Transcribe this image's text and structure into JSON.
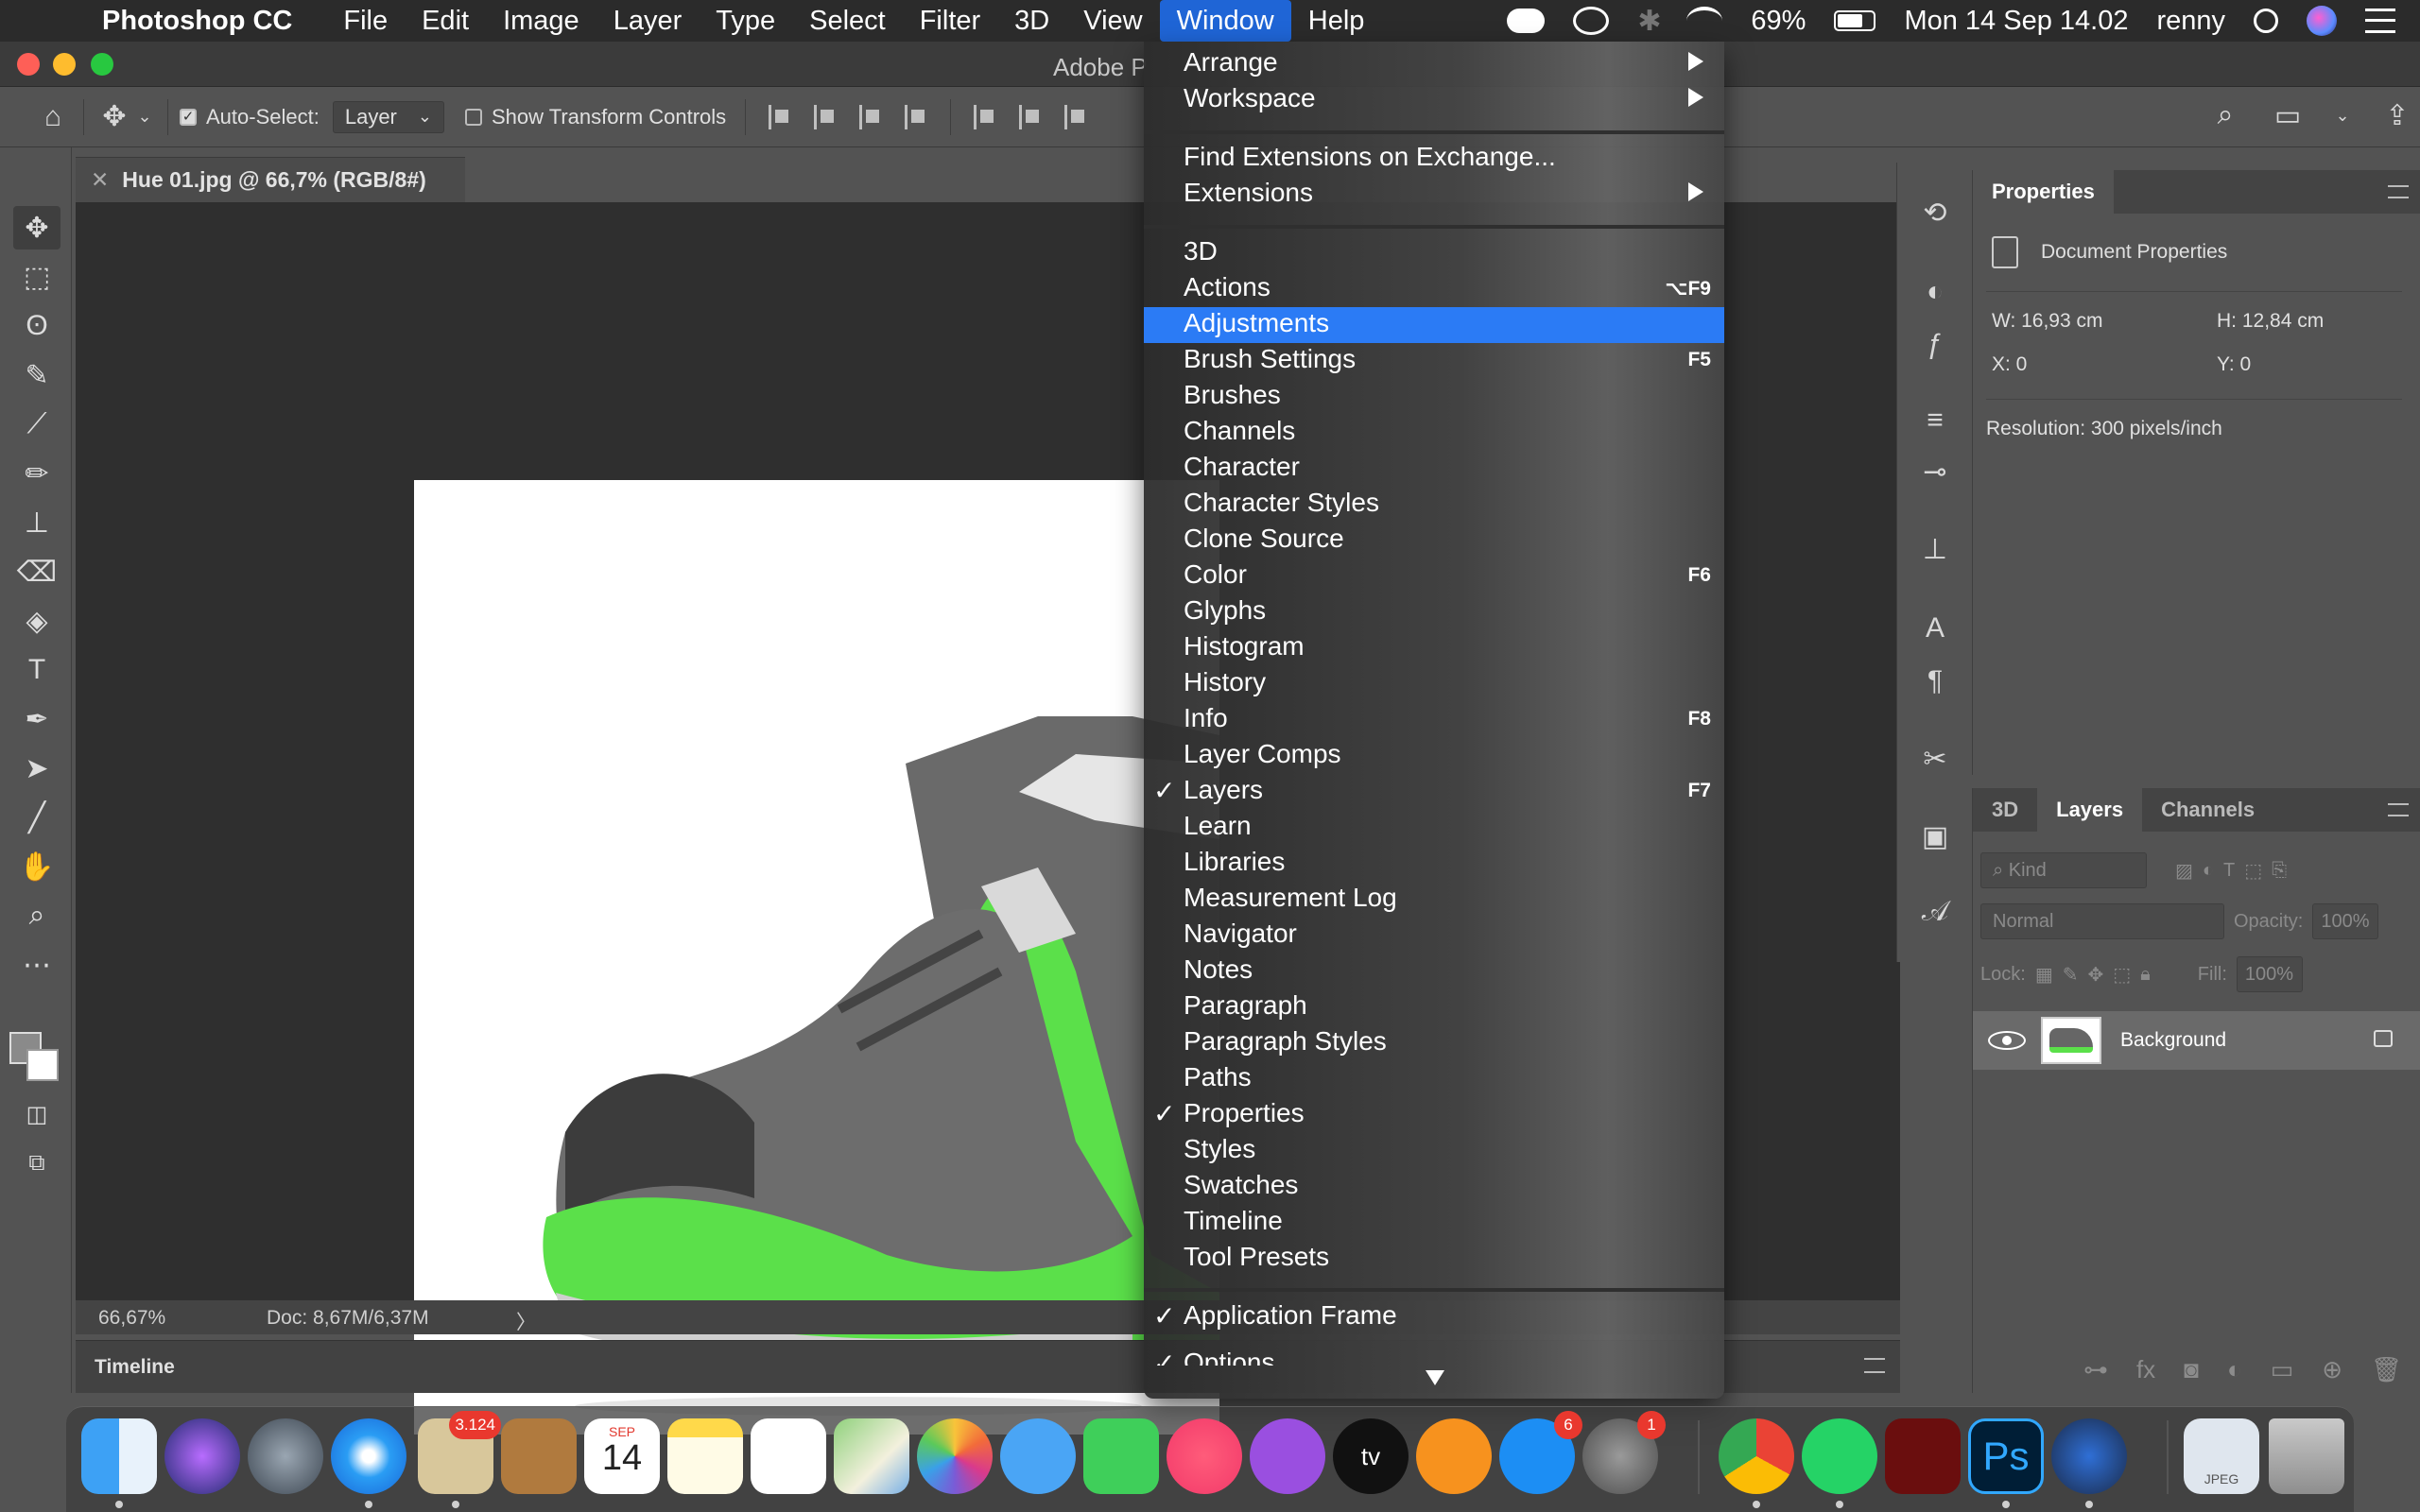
{
  "menubar": {
    "app_name": "Photoshop CC",
    "items": [
      "File",
      "Edit",
      "Image",
      "Layer",
      "Type",
      "Select",
      "Filter",
      "3D",
      "View",
      "Window",
      "Help"
    ],
    "active_item": "Window",
    "battery": "69%",
    "datetime": "Mon 14 Sep  14.02",
    "user": "renny"
  },
  "window": {
    "title": "Adobe P"
  },
  "options_bar": {
    "auto_select_label": "Auto-Select:",
    "auto_select_checked": true,
    "auto_select_value": "Layer",
    "transform_controls_label": "Show Transform Controls"
  },
  "document": {
    "tab_title": "Hue 01.jpg @ 66,7% (RGB/8#)",
    "zoom": "66,67%",
    "doc_info": "Doc: 8,67M/6,37M"
  },
  "timeline": {
    "label": "Timeline"
  },
  "properties_panel": {
    "tab": "Properties",
    "section": "Document Properties",
    "width": "W:  16,93 cm",
    "height": "H:  12,84 cm",
    "x": "X:  0",
    "y": "Y:  0",
    "resolution": "Resolution: 300 pixels/inch"
  },
  "layers_panel": {
    "tabs": [
      "3D",
      "Layers",
      "Channels"
    ],
    "active_tab": "Layers",
    "kind_placeholder": "Kind",
    "blend_mode": "Normal",
    "opacity_label": "Opacity:",
    "opacity_value": "100%",
    "lock_label": "Lock:",
    "fill_label": "Fill:",
    "fill_value": "100%",
    "layer_name": "Background"
  },
  "window_menu": {
    "items": [
      {
        "label": "Arrange",
        "submenu": true
      },
      {
        "label": "Workspace",
        "submenu": true
      },
      {
        "label": "Find Extensions on Exchange..."
      },
      {
        "label": "Extensions",
        "submenu": true
      },
      {
        "label": "3D"
      },
      {
        "label": "Actions",
        "shortcut": "⌥F9"
      },
      {
        "label": "Adjustments",
        "highlighted": true
      },
      {
        "label": "Brush Settings",
        "shortcut": "F5"
      },
      {
        "label": "Brushes"
      },
      {
        "label": "Channels"
      },
      {
        "label": "Character"
      },
      {
        "label": "Character Styles"
      },
      {
        "label": "Clone Source"
      },
      {
        "label": "Color",
        "shortcut": "F6"
      },
      {
        "label": "Glyphs"
      },
      {
        "label": "Histogram"
      },
      {
        "label": "History"
      },
      {
        "label": "Info",
        "shortcut": "F8"
      },
      {
        "label": "Layer Comps"
      },
      {
        "label": "Layers",
        "shortcut": "F7",
        "checked": true
      },
      {
        "label": "Learn"
      },
      {
        "label": "Libraries"
      },
      {
        "label": "Measurement Log"
      },
      {
        "label": "Navigator"
      },
      {
        "label": "Notes"
      },
      {
        "label": "Paragraph"
      },
      {
        "label": "Paragraph Styles"
      },
      {
        "label": "Paths"
      },
      {
        "label": "Properties",
        "checked": true
      },
      {
        "label": "Styles"
      },
      {
        "label": "Swatches"
      },
      {
        "label": "Timeline"
      },
      {
        "label": "Tool Presets"
      },
      {
        "label": "Application Frame",
        "checked": true
      },
      {
        "label": "Options",
        "checked": true
      }
    ]
  },
  "dock": {
    "mail_badge": "3.124",
    "calendar_month": "SEP",
    "calendar_day": "14",
    "appstore_badge": "6",
    "prefs_badge": "1",
    "tv_label": "tv",
    "photoshop_label": "Ps",
    "preview_label": "JPEG"
  },
  "colors": {
    "menu_highlight": "#2b7bf5",
    "menubar_active": "#1f65d6",
    "shoe_green": "#5be04a"
  }
}
